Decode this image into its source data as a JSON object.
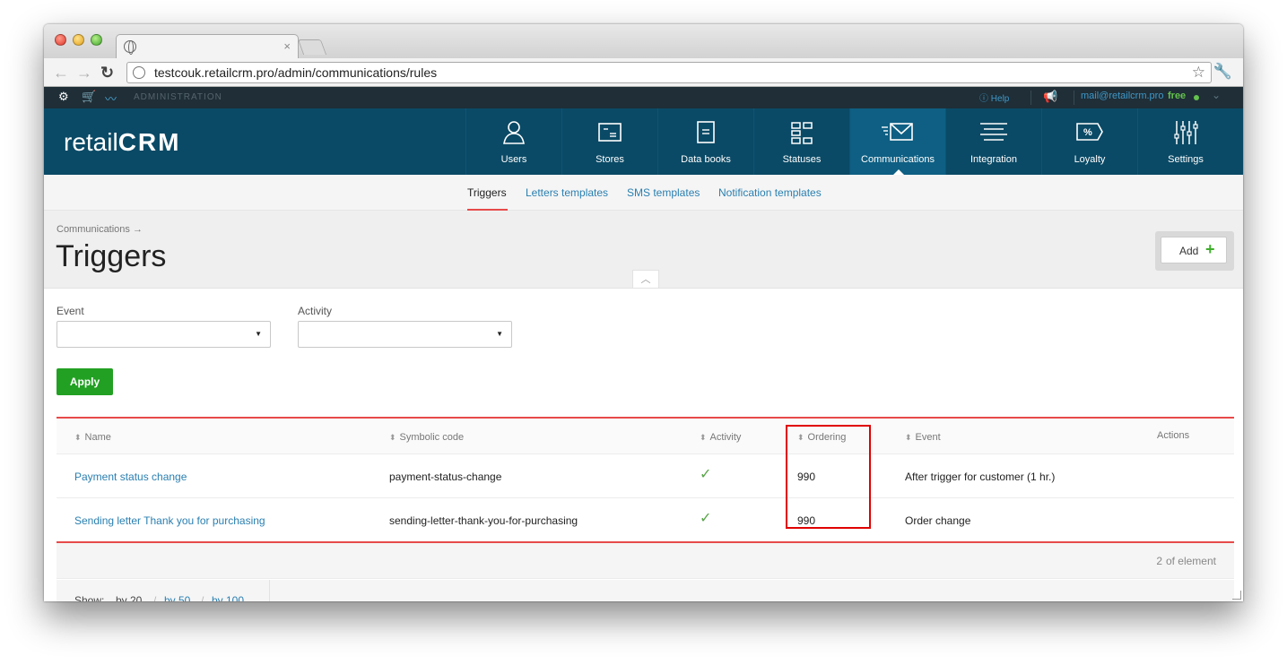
{
  "browser": {
    "url": "testcouk.retailcrm.pro/admin/communications/rules",
    "tab_close": "×"
  },
  "admin_strip": {
    "label": "ADMINISTRATION",
    "help": "Help",
    "email": "mail@retailcrm.pro",
    "plan": "free"
  },
  "header": {
    "logo_text": "retail",
    "logo_crm": "CRM",
    "nav": [
      {
        "label": "Users",
        "icon": "user-icon"
      },
      {
        "label": "Stores",
        "icon": "store-icon"
      },
      {
        "label": "Data books",
        "icon": "book-icon"
      },
      {
        "label": "Statuses",
        "icon": "statuses-icon"
      },
      {
        "label": "Communications",
        "icon": "communications-icon"
      },
      {
        "label": "Integration",
        "icon": "integration-icon"
      },
      {
        "label": "Loyalty",
        "icon": "loyalty-icon"
      },
      {
        "label": "Settings",
        "icon": "settings-icon"
      }
    ],
    "active": "Communications"
  },
  "subnav": {
    "items": [
      "Triggers",
      "Letters templates",
      "SMS templates",
      "Notification templates"
    ],
    "active": "Triggers"
  },
  "page": {
    "breadcrumb": "Communications →",
    "title": "Triggers",
    "add_label": "Add",
    "add_plus": "+"
  },
  "filters": {
    "event_label": "Event",
    "activity_label": "Activity",
    "event_value": "",
    "activity_value": "",
    "apply_label": "Apply"
  },
  "table": {
    "columns": [
      "Name",
      "Symbolic code",
      "Activity",
      "Ordering",
      "Event",
      "Actions"
    ],
    "rows": [
      {
        "name": "Payment status change",
        "code": "payment-status-change",
        "active": true,
        "ordering": "990",
        "event": "After trigger for customer (1 hr.)"
      },
      {
        "name": "Sending letter Thank you for purchasing",
        "code": "sending-letter-thank-you-for-purchasing",
        "active": true,
        "ordering": "990",
        "event": "Order change"
      }
    ],
    "count": "2",
    "count_label": "of element"
  },
  "pagination": {
    "show_label": "Show:",
    "options": [
      "by 20",
      "by 50",
      "by 100"
    ],
    "selected": "by 20"
  },
  "colors": {
    "header_bg": "#0a4a66",
    "accent_red": "#e74a4a",
    "apply_green": "#22a023",
    "link_blue": "#2a7fb0",
    "highlight_red": "#e00000"
  }
}
